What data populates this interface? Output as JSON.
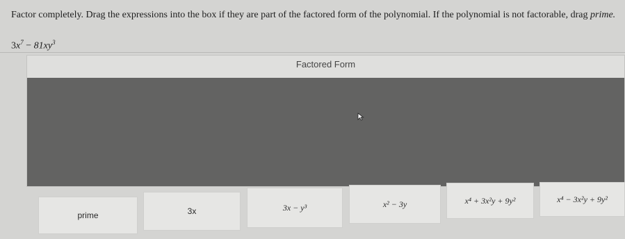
{
  "instructions": {
    "text_before": "Factor completely. Drag the expressions into the box if they are part of the factored form of the polynomial. If the polynomial is not factorable, drag",
    "prime_word": "prime."
  },
  "polynomial": {
    "coef": "3",
    "var1": "x",
    "exp1": "7",
    "op": "−",
    "term2": "81xy",
    "exp2": "3"
  },
  "factored_panel": {
    "title": "Factored Form"
  },
  "tiles": [
    {
      "label": "prime"
    },
    {
      "label": "3x"
    },
    {
      "label": "3x − y³"
    },
    {
      "label": "x² − 3y"
    },
    {
      "label": "x⁴ + 3x²y + 9y²"
    },
    {
      "label": "x⁴ − 3x²y + 9y²"
    }
  ]
}
